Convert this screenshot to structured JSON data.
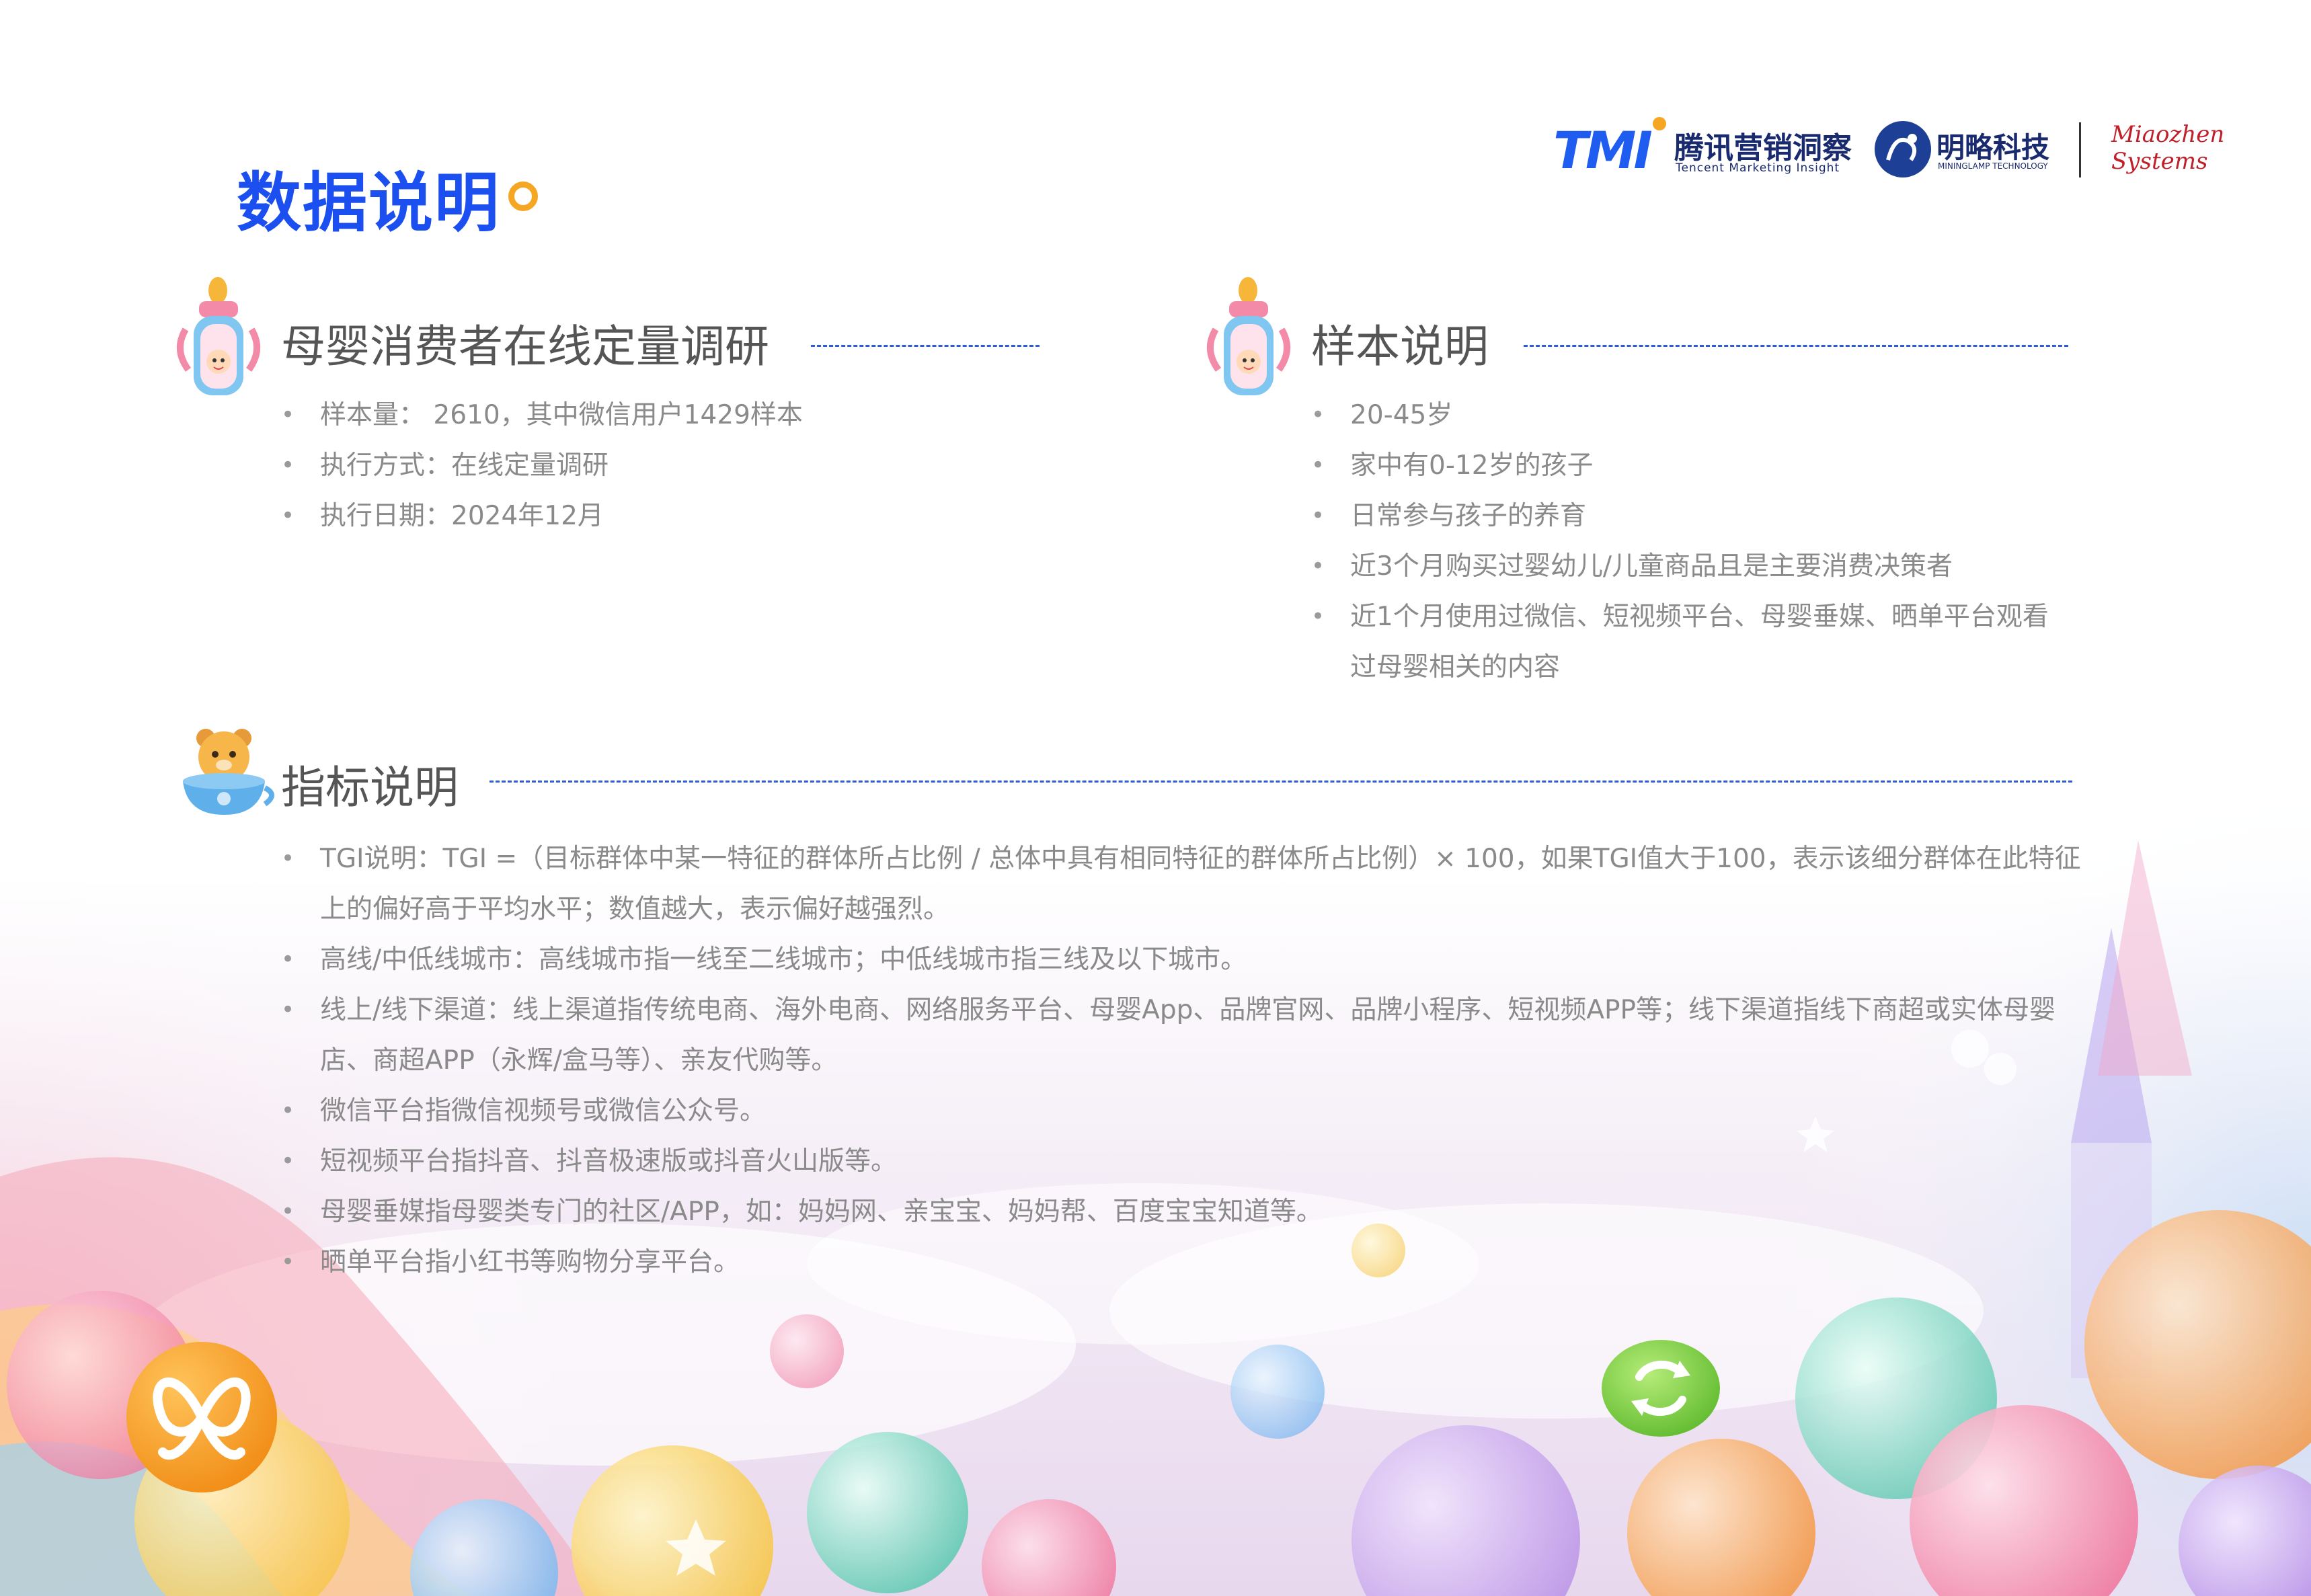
{
  "header": {
    "tmi_logo_text": "TMI",
    "tmi_name_cn": "腾讯营销洞察",
    "tmi_name_en": "Tencent Marketing Insight",
    "ml_name_cn": "明略科技",
    "ml_name_en": "MININGLAMP TECHNOLOGY",
    "mz_name_line1": "Miaozhen",
    "mz_name_line2": "Systems"
  },
  "page_title": "数据说明",
  "survey": {
    "heading": "母婴消费者在线定量调研",
    "items": [
      "样本量： 2610，其中微信用户1429样本",
      "执行方式：在线定量调研",
      "执行日期：2024年12月"
    ]
  },
  "sample": {
    "heading": "样本说明",
    "items": [
      "20-45岁",
      "家中有0-12岁的孩子",
      "日常参与孩子的养育",
      "近3个月购买过婴幼儿/儿童商品且是主要消费决策者",
      "近1个月使用过微信、短视频平台、母婴垂媒、晒单平台观看过母婴相关的内容"
    ]
  },
  "metrics": {
    "heading": "指标说明",
    "items": [
      "TGI说明：TGI =（目标群体中某一特征的群体所占比例 / 总体中具有相同特征的群体所占比例）× 100，如果TGI值大于100，表示该细分群体在此特征上的偏好高于平均水平；数值越大，表示偏好越强烈。",
      "高线/中低线城市：高线城市指一线至二线城市；中低线城市指三线及以下城市。",
      "线上/线下渠道：线上渠道指传统电商、海外电商、网络服务平台、母婴App、品牌官网、品牌小程序、短视频APP等；线下渠道指线下商超或实体母婴店、商超APP（永辉/盒马等）、亲友代购等。",
      "微信平台指微信视频号或微信公众号。",
      "短视频平台指抖音、抖音极速版或抖音火山版等。",
      "母婴垂媒指母婴类专门的社区/APP，如：妈妈网、亲宝宝、妈妈帮、百度宝宝知道等。",
      "晒单平台指小红书等购物分享平台。"
    ]
  },
  "colors": {
    "title_blue": "#1c4ff0",
    "accent_orange": "#f5a623",
    "heading_gray": "#555555",
    "bullet_gray": "#8a8a8a"
  },
  "icons": [
    "baby-bottle-icon",
    "baby-bottle-icon",
    "teddy-bear-cup-icon",
    "butterfly-logo-icon",
    "recycle-logo-icon"
  ]
}
